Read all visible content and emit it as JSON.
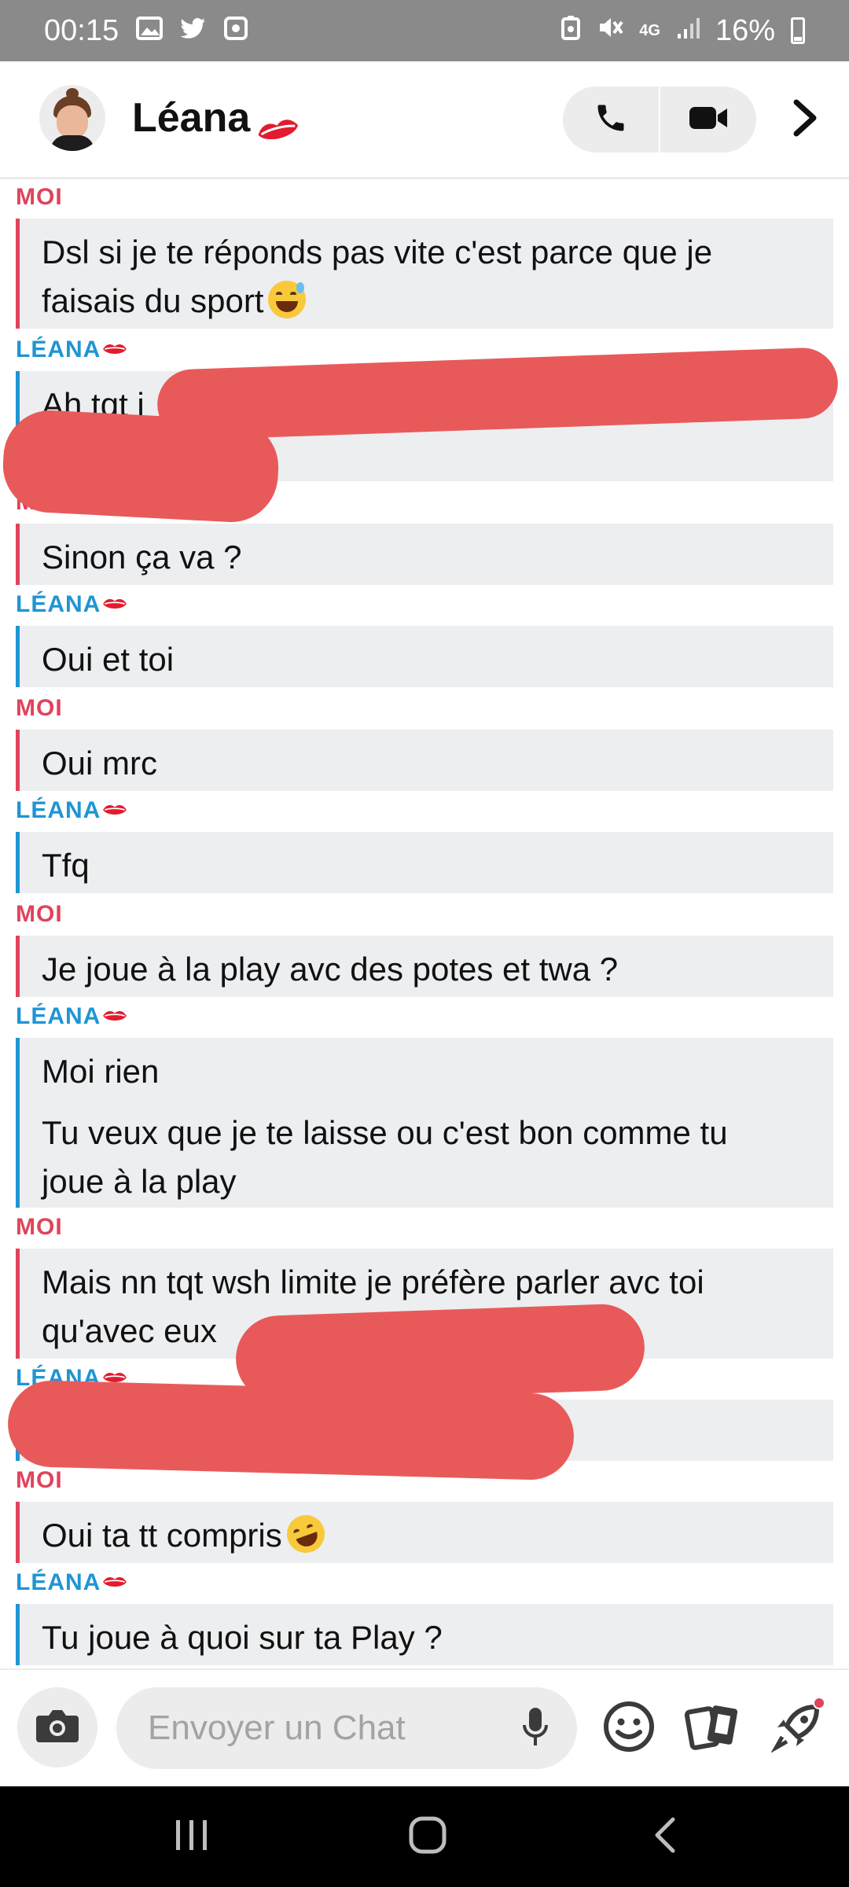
{
  "status_bar": {
    "time": "00:15",
    "network": "4G",
    "battery": "16%"
  },
  "header": {
    "contact_name": "Léana",
    "contact_emoji_icon": "kiss-lips-icon"
  },
  "messages": [
    {
      "sender": "MOI",
      "lines": [
        "Dsl si je te réponds pas vite c'est parce que je",
        "faisais du sport"
      ]
    },
    {
      "sender": "LÉANA",
      "lines": [
        "Ah tqt j"
      ]
    },
    {
      "sender": "MOI",
      "lines": [
        "Sinon ça va ?"
      ]
    },
    {
      "sender": "LÉANA",
      "lines": [
        "Oui et toi"
      ]
    },
    {
      "sender": "MOI",
      "lines": [
        "Oui mrc"
      ]
    },
    {
      "sender": "LÉANA",
      "lines": [
        "Tfq"
      ]
    },
    {
      "sender": "MOI",
      "lines": [
        "Je joue à la play avc des potes et twa ?"
      ]
    },
    {
      "sender": "LÉANA",
      "lines": [
        "Moi rien",
        "Tu veux que je te laisse ou c'est bon comme tu",
        "joue à la play"
      ]
    },
    {
      "sender": "MOI",
      "lines": [
        "Mais nn tqt wsh limite je préfère parler avc toi",
        "qu'avec eux"
      ]
    },
    {
      "sender": "LÉANA",
      "lines": [
        ""
      ]
    },
    {
      "sender": "MOI",
      "lines": [
        "Oui ta tt compris"
      ]
    },
    {
      "sender": "LÉANA",
      "lines": [
        "Tu joue à quoi sur ta Play ?"
      ]
    }
  ],
  "input": {
    "placeholder": "Envoyer un Chat"
  },
  "colors": {
    "me_accent": "#e0435b",
    "her_accent": "#1f95d3",
    "bubble_bg": "#edeef0",
    "redaction": "#e85a5a"
  }
}
